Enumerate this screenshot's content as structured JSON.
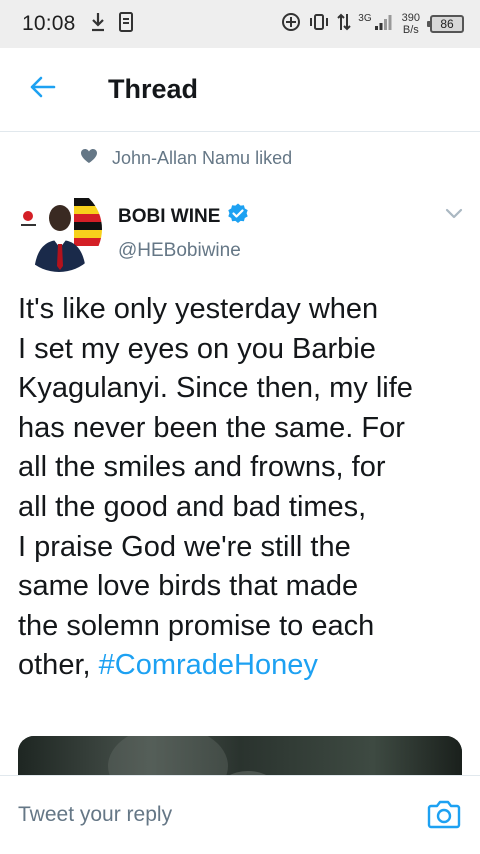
{
  "status_bar": {
    "time": "10:08",
    "net_speed_value": "390",
    "net_speed_unit": "B/s",
    "network_type": "3G",
    "battery_level": "86",
    "icons": [
      "download-icon",
      "storage-icon",
      "data-saver-icon",
      "vibrate-icon",
      "data-transfer-icon",
      "signal-icon",
      "battery-icon"
    ]
  },
  "header": {
    "title": "Thread",
    "back_icon": "back-arrow-icon"
  },
  "social_context": {
    "text": "John-Allan Namu liked",
    "icon": "heart-icon"
  },
  "tweet": {
    "author_name": "BOBI WINE",
    "verified": true,
    "handle": "@HEBobiwine",
    "text_plain": "It's like only yesterday when\nI set my eyes on you Barbie\nKyagulanyi. Since then, my life\nhas never been the same. For\nall the smiles and frowns, for\nall the good and bad times,\nI praise God we're still the\nsame love birds that made\nthe solemn promise to each\nother, ",
    "hashtag": "#ComradeHoney"
  },
  "reply_bar": {
    "placeholder": "Tweet your reply",
    "camera_icon": "camera-icon"
  },
  "colors": {
    "accent": "#1da1f2",
    "secondary_text": "#657786",
    "primary_text": "#14171a",
    "status_bar_bg": "#eeeeee"
  }
}
